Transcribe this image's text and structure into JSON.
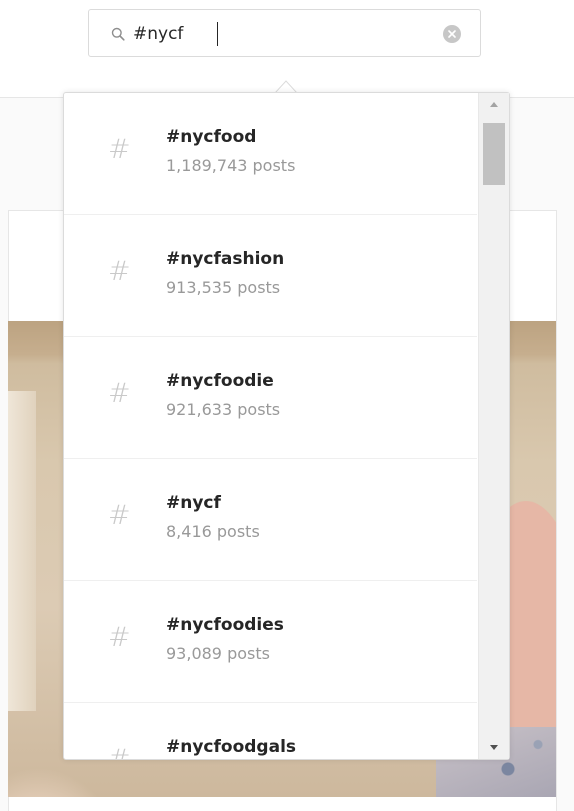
{
  "search": {
    "value": "#nycf",
    "icon": "search-icon",
    "clear_icon": "clear-icon"
  },
  "suggestions": [
    {
      "name": "#nycfood",
      "count": "1,189,743 posts"
    },
    {
      "name": "#nycfashion",
      "count": "913,535 posts"
    },
    {
      "name": "#nycfoodie",
      "count": "921,633 posts"
    },
    {
      "name": "#nycf",
      "count": "8,416 posts"
    },
    {
      "name": "#nycfoodies",
      "count": "93,089 posts"
    },
    {
      "name": "#nycfoodgals",
      "count": ""
    }
  ],
  "hash_symbol": "#",
  "colors": {
    "text_primary": "#262626",
    "text_secondary": "#999999",
    "border": "#dbdbdb",
    "scrollbar_thumb": "#c1c1c1"
  }
}
